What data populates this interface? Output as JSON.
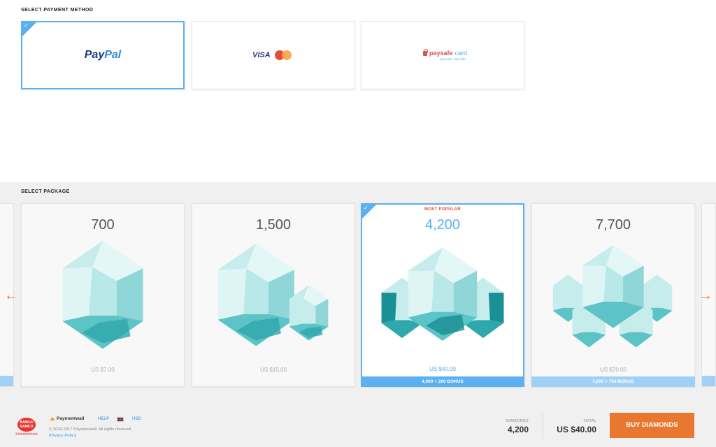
{
  "payment": {
    "section_title": "SELECT PAYMENT METHOD",
    "methods": [
      {
        "name": "PayPal",
        "part1": "Pay",
        "part2": "Pal",
        "selected": true
      },
      {
        "name": "VISA",
        "selected": false
      },
      {
        "name": "paysafecard",
        "part1": "paysafe",
        "part2": "card",
        "tagline": "pay.cash. pay.safe",
        "selected": false
      }
    ]
  },
  "packages": {
    "section_title": "SELECT PACKAGE",
    "items": [
      {
        "amount": "700",
        "price": "US $7.00",
        "gems": 1,
        "selected": false
      },
      {
        "amount": "1,500",
        "price": "US $15.00",
        "gems": 2,
        "selected": false
      },
      {
        "amount": "4,200",
        "price": "US $40.00",
        "badge": "MOST POPULAR",
        "bonus": "4,000 + 200 BONUS",
        "gems": 3,
        "selected": true
      },
      {
        "amount": "7,700",
        "price": "US $70.00",
        "bonus": "7,000 + 700 BONUS",
        "gems": 5,
        "selected": false
      }
    ],
    "prev_icon": "arrow-left-icon",
    "next_icon": "arrow-right-icon"
  },
  "footer": {
    "brand_logo_text": "BANDAI NAMCO",
    "brand_sub": "Entertainment",
    "paymentwall": "Paymentwall",
    "help": "HELP",
    "currency": "USD",
    "copyright": "© 2010-2017 Paymentwall. All rights reserved.",
    "privacy": "Privacy Policy",
    "diamonds_label": "DIAMONDS",
    "diamonds_value": "4,200",
    "total_label": "TOTAL",
    "total_value": "US $40.00",
    "buy_label": "BUY DIAMONDS"
  },
  "colors": {
    "accent": "#5ab0f0",
    "buy": "#e8782f",
    "popular": "#e64c2e"
  }
}
